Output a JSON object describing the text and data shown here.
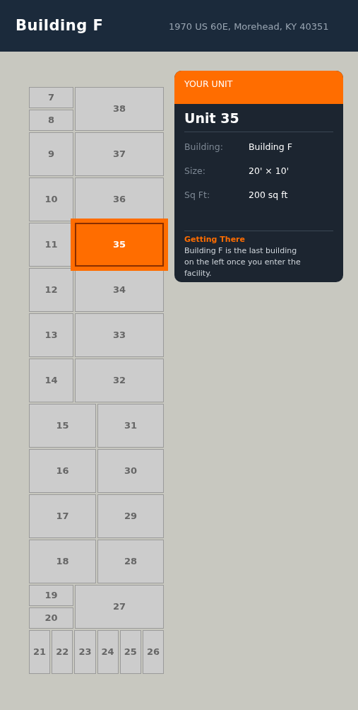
{
  "header": {
    "title": "Building F",
    "address": "1970 US 60E, Morehead, KY 40351"
  },
  "map": {
    "rows": [
      {
        "kind": "stack-left",
        "units": [
          {
            "label": "7",
            "selected": false
          },
          {
            "label": "8",
            "selected": false
          },
          {
            "label": "38",
            "selected": false
          }
        ]
      },
      {
        "kind": "narrow-wide",
        "units": [
          {
            "label": "9",
            "selected": false
          },
          {
            "label": "37",
            "selected": false
          }
        ]
      },
      {
        "kind": "narrow-wide",
        "units": [
          {
            "label": "10",
            "selected": false
          },
          {
            "label": "36",
            "selected": false
          }
        ]
      },
      {
        "kind": "narrow-wide",
        "units": [
          {
            "label": "11",
            "selected": false
          },
          {
            "label": "35",
            "selected": true
          }
        ]
      },
      {
        "kind": "narrow-wide",
        "units": [
          {
            "label": "12",
            "selected": false
          },
          {
            "label": "34",
            "selected": false
          }
        ]
      },
      {
        "kind": "narrow-wide",
        "units": [
          {
            "label": "13",
            "selected": false
          },
          {
            "label": "33",
            "selected": false
          }
        ]
      },
      {
        "kind": "narrow-wide",
        "units": [
          {
            "label": "14",
            "selected": false
          },
          {
            "label": "32",
            "selected": false
          }
        ]
      },
      {
        "kind": "even",
        "units": [
          {
            "label": "15",
            "selected": false
          },
          {
            "label": "31",
            "selected": false
          }
        ]
      },
      {
        "kind": "even",
        "units": [
          {
            "label": "16",
            "selected": false
          },
          {
            "label": "30",
            "selected": false
          }
        ]
      },
      {
        "kind": "even",
        "units": [
          {
            "label": "17",
            "selected": false
          },
          {
            "label": "29",
            "selected": false
          }
        ]
      },
      {
        "kind": "even",
        "units": [
          {
            "label": "18",
            "selected": false
          },
          {
            "label": "28",
            "selected": false
          }
        ]
      },
      {
        "kind": "stack-left",
        "units": [
          {
            "label": "19",
            "selected": false
          },
          {
            "label": "20",
            "selected": false
          },
          {
            "label": "27",
            "selected": false
          }
        ]
      },
      {
        "kind": "strip",
        "units": [
          {
            "label": "21",
            "selected": false
          },
          {
            "label": "22",
            "selected": false
          },
          {
            "label": "23",
            "selected": false
          },
          {
            "label": "24",
            "selected": false
          },
          {
            "label": "25",
            "selected": false
          },
          {
            "label": "26",
            "selected": false
          }
        ]
      }
    ]
  },
  "card": {
    "badge": "YOUR UNIT",
    "title": "Unit 35",
    "details": [
      {
        "label": "Building:",
        "value": "Building F"
      },
      {
        "label": "Size:",
        "value": "20' × 10'"
      },
      {
        "label": "Sq Ft:",
        "value": "200 sq ft"
      }
    ],
    "directions_title": "Getting There",
    "directions": "Building F is the last building on the left once you enter the facility."
  }
}
